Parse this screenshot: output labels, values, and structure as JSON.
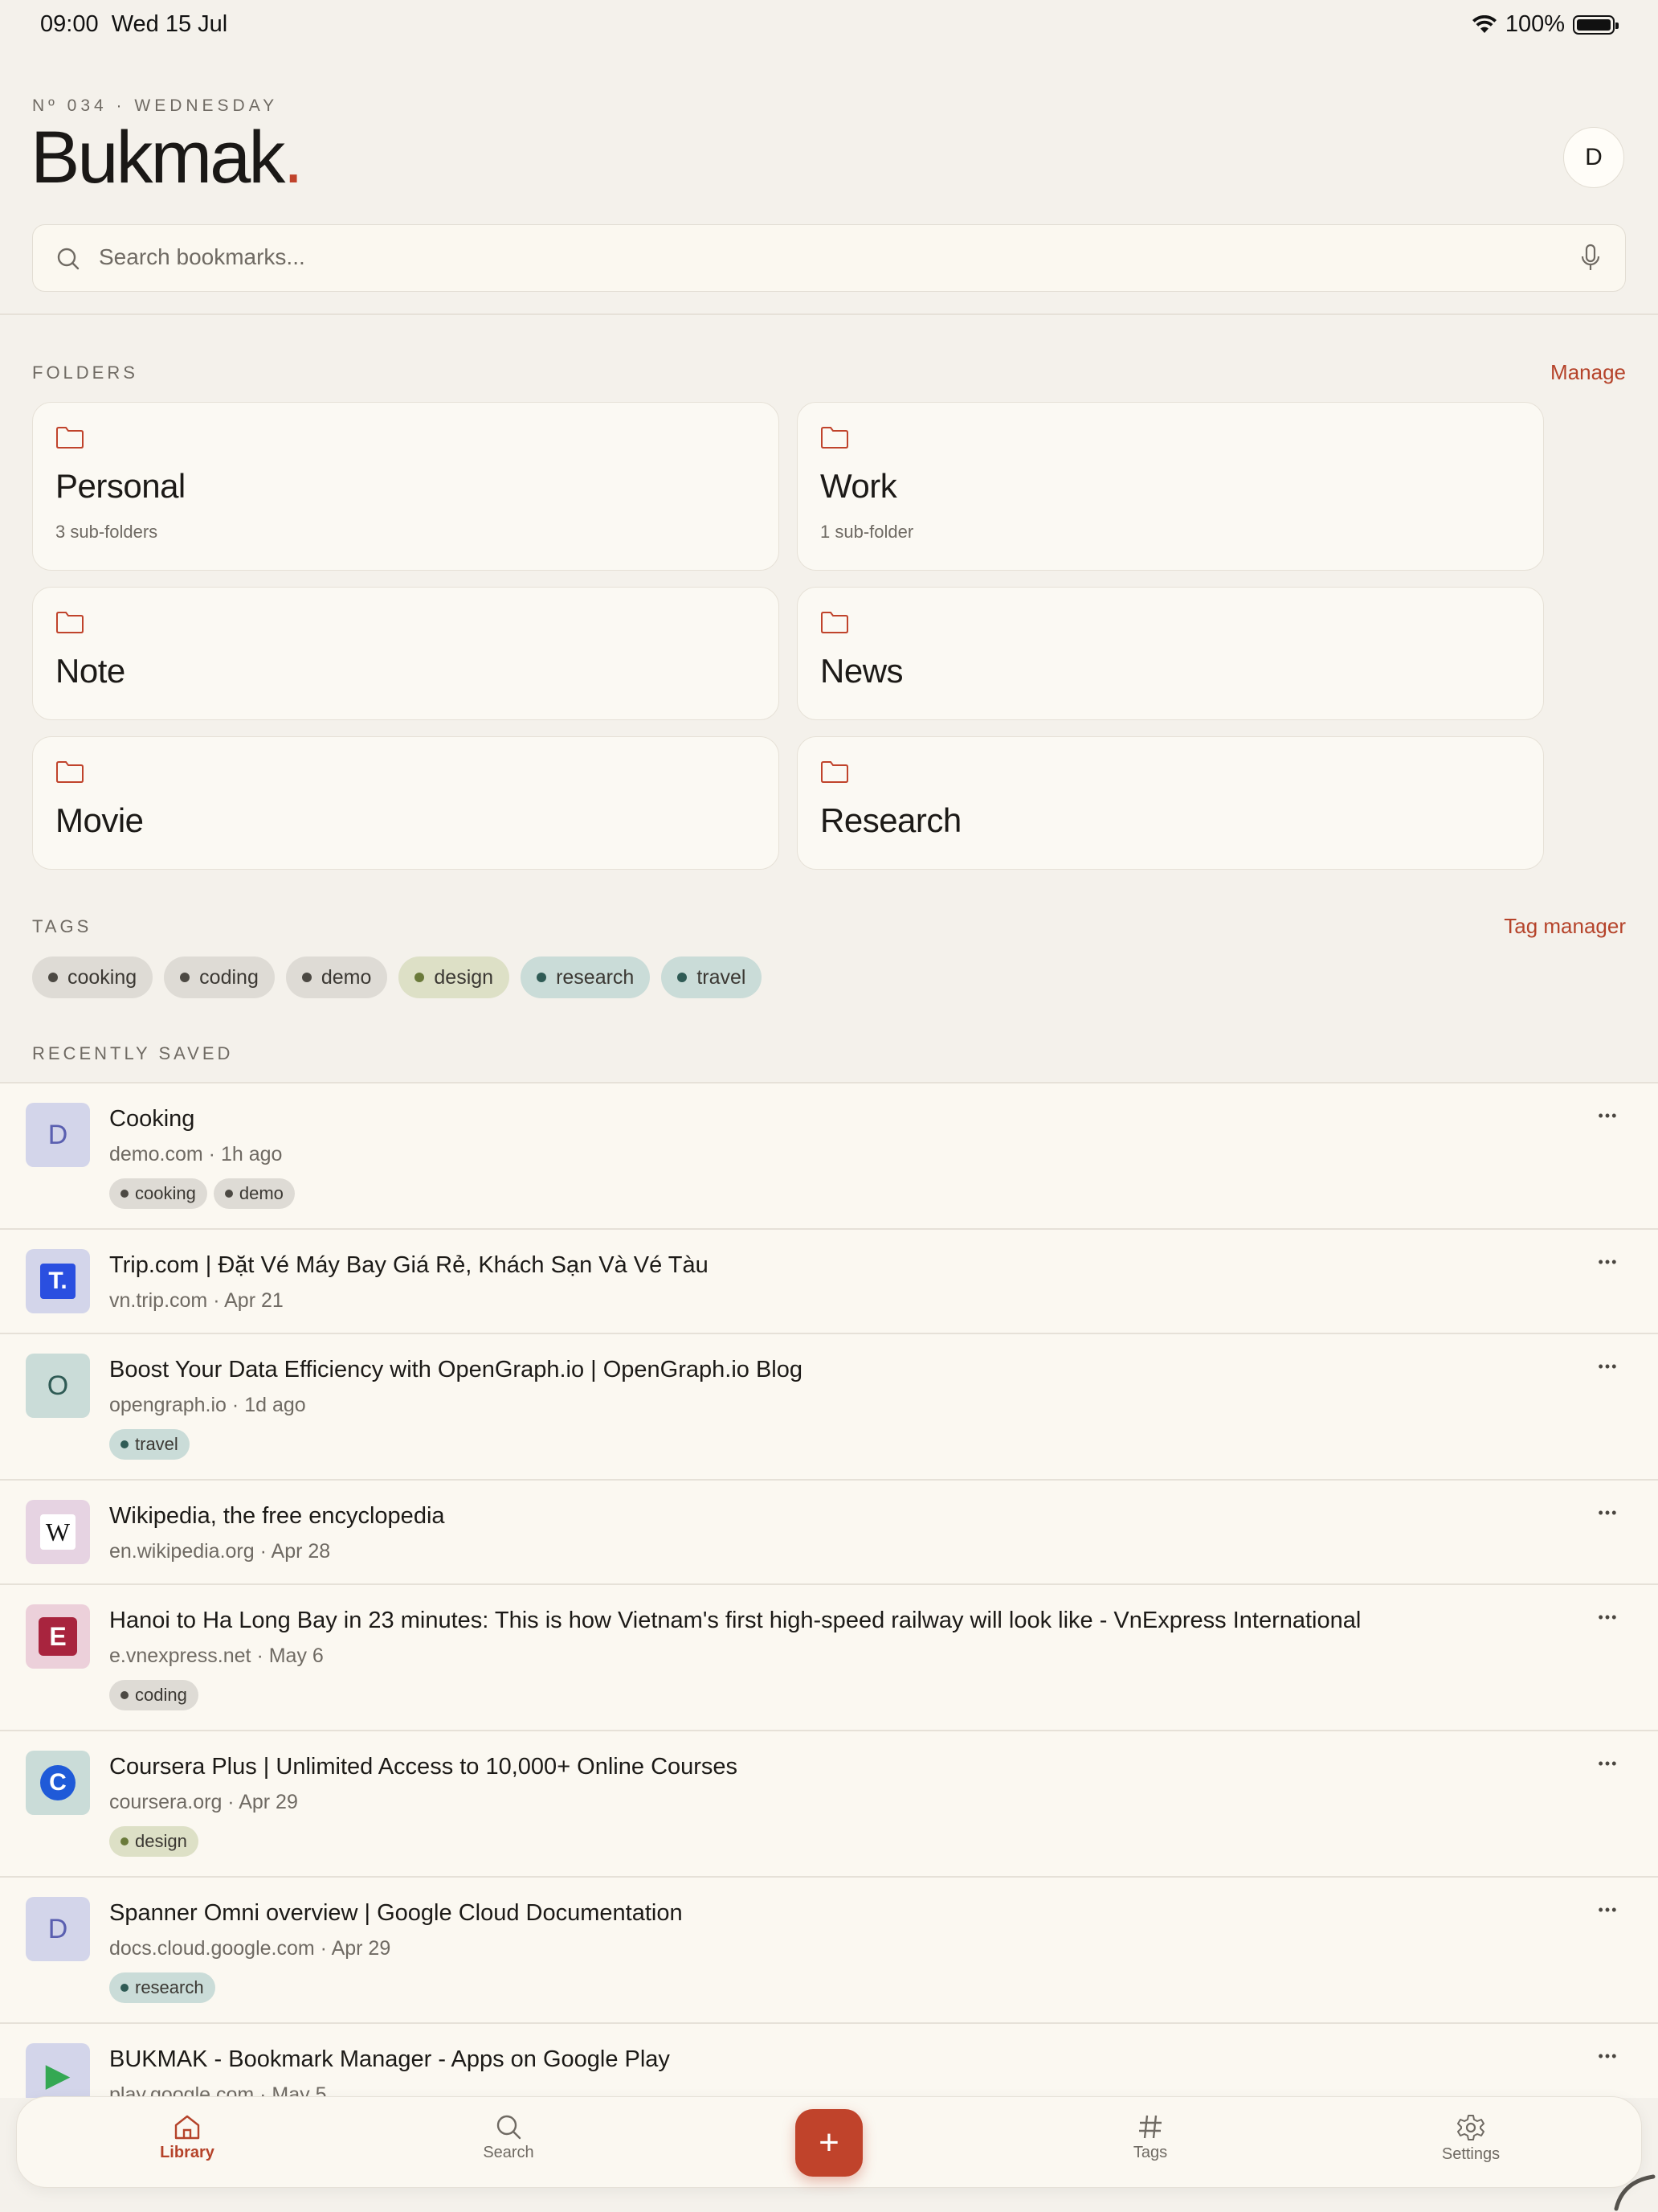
{
  "status": {
    "time": "09:00",
    "date": "Wed 15 Jul",
    "battery": "100%"
  },
  "header": {
    "issue": "Nº 034 · WEDNESDAY",
    "title": "Bukmak",
    "title_dot": ".",
    "avatar_initial": "D"
  },
  "search": {
    "placeholder": "Search bookmarks..."
  },
  "folders": {
    "label": "FOLDERS",
    "manage": "Manage",
    "items": [
      {
        "name": "Personal",
        "sub": "3 sub-folders"
      },
      {
        "name": "Work",
        "sub": "1 sub-folder"
      },
      {
        "name": "Note",
        "sub": ""
      },
      {
        "name": "News",
        "sub": ""
      },
      {
        "name": "Movie",
        "sub": ""
      },
      {
        "name": "Research",
        "sub": ""
      }
    ]
  },
  "tags": {
    "label": "TAGS",
    "manager": "Tag manager",
    "items": [
      {
        "name": "cooking",
        "bg": "#dedbd5",
        "dot": "#4c4943"
      },
      {
        "name": "coding",
        "bg": "#dedbd5",
        "dot": "#4c4943"
      },
      {
        "name": "demo",
        "bg": "#dedbd5",
        "dot": "#4c4943"
      },
      {
        "name": "design",
        "bg": "#dde0c6",
        "dot": "#6a7a3a"
      },
      {
        "name": "research",
        "bg": "#cadcd8",
        "dot": "#2f5b55"
      },
      {
        "name": "travel",
        "bg": "#cadcd8",
        "dot": "#2f5b55"
      }
    ]
  },
  "recent": {
    "label": "RECENTLY SAVED",
    "items": [
      {
        "title": "Cooking",
        "domain": "demo.com",
        "time": "1h ago",
        "thumb": "D",
        "thumb_bg": "#d3d5ea",
        "thumb_color": "#5a5fb0",
        "icon": "letter-d-icon",
        "tags": [
          "cooking",
          "demo"
        ]
      },
      {
        "title": "Trip.com | Đặt Vé Máy Bay Giá Rẻ, Khách Sạn Và Vé Tàu",
        "domain": "vn.trip.com",
        "time": "Apr 21",
        "thumb": "T.",
        "thumb_bg": "#d3d5ea",
        "thumb_color": "#ffffff",
        "icon": "trip-com-logo-icon",
        "tags": []
      },
      {
        "title": "Boost Your Data Efficiency with OpenGraph.io | OpenGraph.io Blog",
        "domain": "opengraph.io",
        "time": "1d ago",
        "thumb": "O",
        "thumb_bg": "#cadcd8",
        "thumb_color": "#2f5b55",
        "icon": "letter-o-icon",
        "tags": [
          "travel"
        ]
      },
      {
        "title": "Wikipedia, the free encyclopedia",
        "domain": "en.wikipedia.org",
        "time": "Apr 28",
        "thumb": "W",
        "thumb_bg": "#e6d3e2",
        "thumb_color": "#111111",
        "icon": "wikipedia-logo-icon",
        "tags": []
      },
      {
        "title": "Hanoi to Ha Long Bay in 23 minutes: This is how Vietnam's first high-speed railway will look like - VnExpress International",
        "domain": "e.vnexpress.net",
        "time": "May 6",
        "thumb": "E",
        "thumb_bg": "#ecd0da",
        "thumb_color": "#ffffff",
        "icon": "vnexpress-logo-icon",
        "tags": [
          "coding"
        ]
      },
      {
        "title": "Coursera Plus | Unlimited Access to 10,000+ Online Courses",
        "domain": "coursera.org",
        "time": "Apr 29",
        "thumb": "C",
        "thumb_bg": "#cadcd8",
        "thumb_color": "#ffffff",
        "icon": "coursera-logo-icon",
        "tags": [
          "design"
        ]
      },
      {
        "title": "Spanner Omni overview  |  Google Cloud Documentation",
        "domain": "docs.cloud.google.com",
        "time": "Apr 29",
        "thumb": "D",
        "thumb_bg": "#d3d5ea",
        "thumb_color": "#5a5fb0",
        "icon": "letter-d-icon",
        "tags": [
          "research"
        ]
      },
      {
        "title": "BUKMAK - Bookmark Manager - Apps on Google Play",
        "domain": "play.google.com",
        "time": "May 5",
        "thumb": "▶",
        "thumb_bg": "#d3d5ea",
        "thumb_color": "#34a853",
        "icon": "google-play-logo-icon",
        "tags": []
      }
    ]
  },
  "tabbar": {
    "tabs": [
      {
        "label": "Library",
        "icon": "home-icon",
        "active": true
      },
      {
        "label": "Search",
        "icon": "search-icon",
        "active": false
      },
      {
        "label": "Tags",
        "icon": "hashtag-icon",
        "active": false
      },
      {
        "label": "Settings",
        "icon": "gear-icon",
        "active": false
      }
    ],
    "add": "+"
  }
}
